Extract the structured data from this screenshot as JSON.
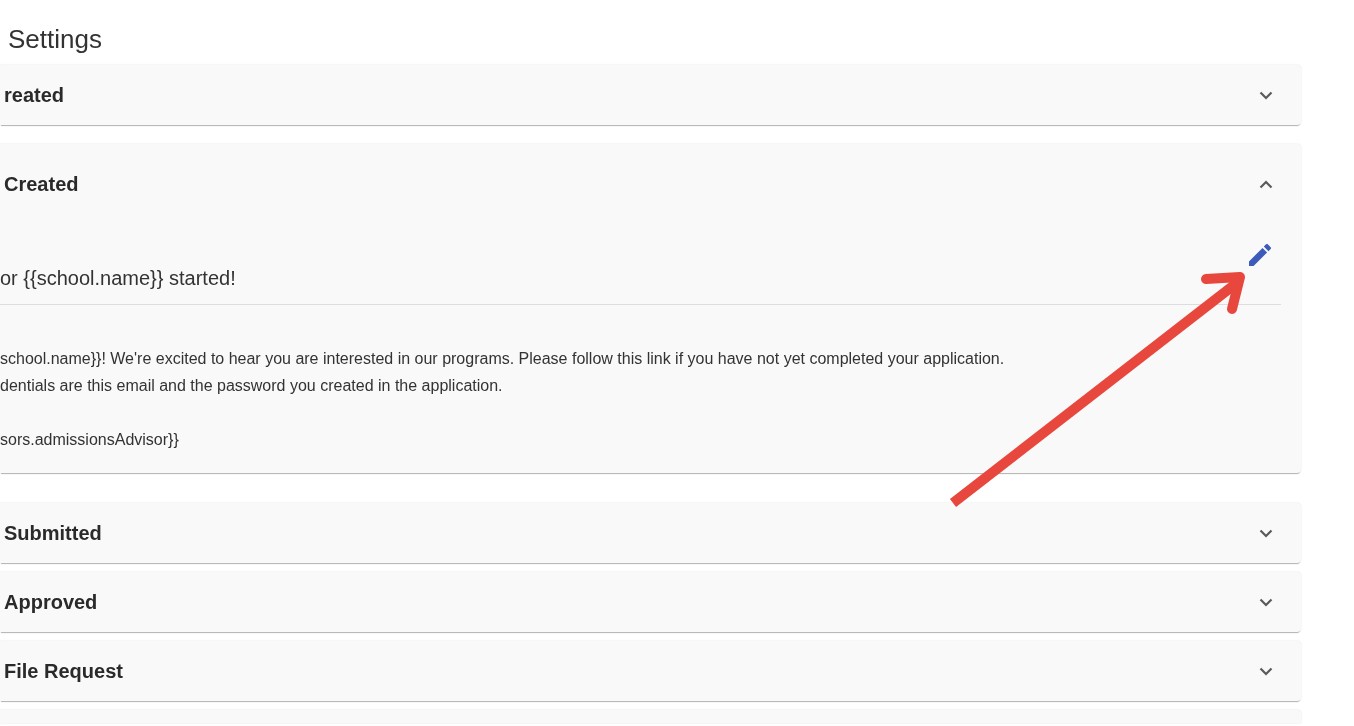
{
  "page": {
    "title": "Settings"
  },
  "panels": [
    {
      "title": "reated",
      "expanded": false
    },
    {
      "title": "Created",
      "expanded": true,
      "details": {
        "subject": "or {{school.name}} started!",
        "body_paragraphs": [
          [
            "school.name}}! We're excited to hear you are interested in our programs. Please follow this link if you have not yet completed your application.",
            "dentials are this email and the password you created in the application."
          ],
          [
            "sors.admissionsAdvisor}}"
          ]
        ]
      }
    },
    {
      "title": "Submitted",
      "expanded": false
    },
    {
      "title": "Approved",
      "expanded": false
    },
    {
      "title": "File Request",
      "expanded": false
    }
  ],
  "cut_off_panel_below": true
}
